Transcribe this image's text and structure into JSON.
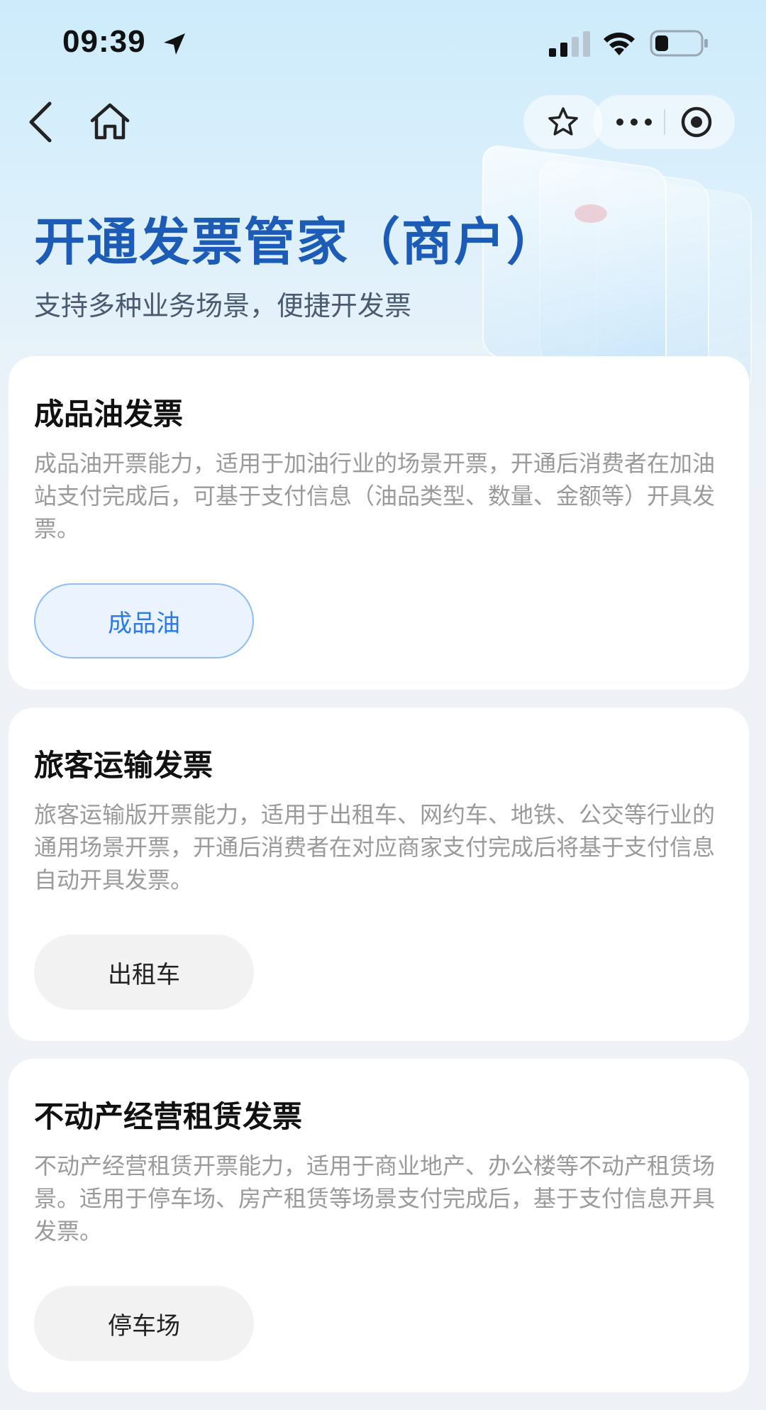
{
  "status_bar": {
    "time": "09:39"
  },
  "nav": {
    "back_icon": "chevron-left-icon",
    "home_icon": "home-icon",
    "favorite_icon": "star-icon",
    "more_icon": "more-dots-icon",
    "close_icon": "target-icon"
  },
  "header": {
    "title": "开通发票管家（商户）",
    "subtitle": "支持多种业务场景，便捷开发票"
  },
  "colors": {
    "title": "#1c5bb6",
    "chip_active_bg": "#eaf3ff",
    "chip_active_border": "#8fbdf5",
    "chip_active_text": "#2d7be5",
    "chip_bg": "#f2f2f2",
    "page_bg": "#eef2f7"
  },
  "cards": [
    {
      "title": "成品油发票",
      "description": "成品油开票能力，适用于加油行业的场景开票，开通后消费者在加油站支付完成后，可基于支付信息（油品类型、数量、金额等）开具发票。",
      "chip": "成品油",
      "chip_selected": true
    },
    {
      "title": "旅客运输发票",
      "description": "旅客运输版开票能力，适用于出租车、网约车、地铁、公交等行业的通用场景开票，开通后消费者在对应商家支付完成后将基于支付信息自动开具发票。",
      "chip": "出租车",
      "chip_selected": false
    },
    {
      "title": "不动产经营租赁发票",
      "description": "不动产经营租赁开票能力，适用于商业地产、办公楼等不动产租赁场景。适用于停车场、房产租赁等场景支付完成后，基于支付信息开具发票。",
      "chip": "停车场",
      "chip_selected": false
    }
  ]
}
